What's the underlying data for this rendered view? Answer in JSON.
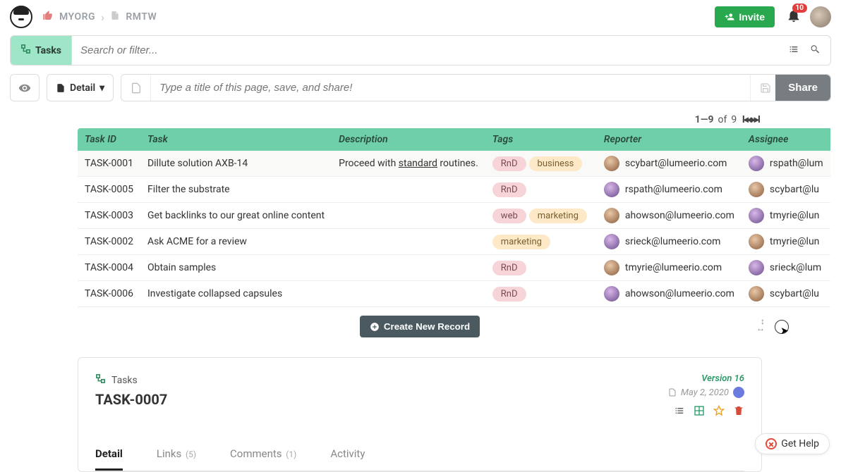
{
  "breadcrumb": {
    "org": "MYORG",
    "page": "RMTW"
  },
  "header": {
    "invite_label": "Invite",
    "notification_count": "10"
  },
  "search": {
    "tasks_label": "Tasks",
    "placeholder": "Search or filter..."
  },
  "detail_bar": {
    "detail_label": "Detail",
    "title_placeholder": "Type a title of this page, save, and share!",
    "share_label": "Share"
  },
  "pager": {
    "range": "1—9",
    "of_label": "of",
    "total": "9"
  },
  "table": {
    "headers": {
      "task_id": "Task ID",
      "task": "Task",
      "description": "Description",
      "tags": "Tags",
      "reporter": "Reporter",
      "assignee": "Assignee"
    },
    "rows": [
      {
        "id": "TASK-0001",
        "task": "Dillute solution AXB-14",
        "desc_pre": "Proceed with ",
        "desc_u": "standard",
        "desc_post": " routines.",
        "tags": [
          "RnD",
          "business"
        ],
        "reporter": "scybart@lumeerio.com",
        "assignee": "rspath@lum"
      },
      {
        "id": "TASK-0005",
        "task": "Filter the substrate",
        "desc_pre": "",
        "desc_u": "",
        "desc_post": "",
        "tags": [
          "RnD"
        ],
        "reporter": "rspath@lumeerio.com",
        "assignee": "scybart@lu"
      },
      {
        "id": "TASK-0003",
        "task": "Get backlinks to our great online content",
        "desc_pre": "",
        "desc_u": "",
        "desc_post": "",
        "tags": [
          "web",
          "marketing"
        ],
        "reporter": "ahowson@lumeerio.com",
        "assignee": "tmyrie@lun"
      },
      {
        "id": "TASK-0002",
        "task": "Ask ACME for a review",
        "desc_pre": "",
        "desc_u": "",
        "desc_post": "",
        "tags": [
          "marketing"
        ],
        "reporter": "srieck@lumeerio.com",
        "assignee": "tmyrie@lun"
      },
      {
        "id": "TASK-0004",
        "task": "Obtain samples",
        "desc_pre": "",
        "desc_u": "",
        "desc_post": "",
        "tags": [
          "RnD"
        ],
        "reporter": "tmyrie@lumeerio.com",
        "assignee": "srieck@lum"
      },
      {
        "id": "TASK-0006",
        "task": "Investigate collapsed capsules",
        "desc_pre": "",
        "desc_u": "",
        "desc_post": "",
        "tags": [
          "RnD"
        ],
        "reporter": "ahowson@lumeerio.com",
        "assignee": "scybart@lu"
      }
    ]
  },
  "create_button": "Create New Record",
  "detail_card": {
    "tasks_label": "Tasks",
    "title": "TASK-0007",
    "version": "Version 16",
    "date": "May 2, 2020",
    "tabs": {
      "detail": "Detail",
      "links": "Links",
      "links_count": "(5)",
      "comments": "Comments",
      "comments_count": "(1)",
      "activity": "Activity"
    }
  },
  "help": {
    "label": "Get Help"
  },
  "tag_classes": {
    "RnD": "tag-rnd",
    "business": "tag-business",
    "web": "tag-web",
    "marketing": "tag-marketing"
  }
}
